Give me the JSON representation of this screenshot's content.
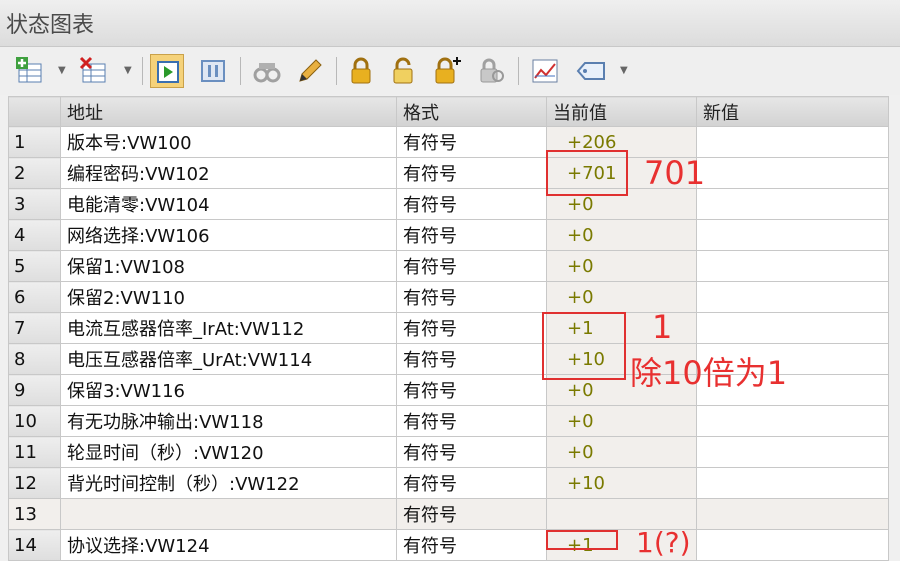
{
  "window": {
    "title": "状态图表"
  },
  "toolbar": {
    "buttons": [
      {
        "icon": "insert-row-icon"
      },
      {
        "icon": "delete-row-icon"
      },
      {
        "icon": "monitor-start-icon"
      },
      {
        "icon": "monitor-pause-icon"
      },
      {
        "icon": "read-icon"
      },
      {
        "icon": "write-pencil-icon"
      },
      {
        "icon": "force-lock-icon"
      },
      {
        "icon": "unforce-unlock-icon"
      },
      {
        "icon": "unforce-all-icon"
      },
      {
        "icon": "read-all-forced-icon"
      },
      {
        "icon": "trend-chart-icon"
      },
      {
        "icon": "tag-icon"
      }
    ]
  },
  "table": {
    "columns": [
      "",
      "地址",
      "格式",
      "当前值",
      "新值"
    ],
    "rows": [
      {
        "num": "1",
        "address": "版本号:VW100",
        "format": "有符号",
        "value": "+206",
        "new": ""
      },
      {
        "num": "2",
        "address": "编程密码:VW102",
        "format": "有符号",
        "value": "+701",
        "new": ""
      },
      {
        "num": "3",
        "address": "电能清零:VW104",
        "format": "有符号",
        "value": "+0",
        "new": ""
      },
      {
        "num": "4",
        "address": "网络选择:VW106",
        "format": "有符号",
        "value": "+0",
        "new": ""
      },
      {
        "num": "5",
        "address": "保留1:VW108",
        "format": "有符号",
        "value": "+0",
        "new": ""
      },
      {
        "num": "6",
        "address": "保留2:VW110",
        "format": "有符号",
        "value": "+0",
        "new": ""
      },
      {
        "num": "7",
        "address": "电流互感器倍率_IrAt:VW112",
        "format": "有符号",
        "value": "+1",
        "new": ""
      },
      {
        "num": "8",
        "address": "电压互感器倍率_UrAt:VW114",
        "format": "有符号",
        "value": "+10",
        "new": ""
      },
      {
        "num": "9",
        "address": "保留3:VW116",
        "format": "有符号",
        "value": "+0",
        "new": ""
      },
      {
        "num": "10",
        "address": "有无功脉冲输出:VW118",
        "format": "有符号",
        "value": "+0",
        "new": ""
      },
      {
        "num": "11",
        "address": "轮显时间（秒）:VW120",
        "format": "有符号",
        "value": "+0",
        "new": ""
      },
      {
        "num": "12",
        "address": "背光时间控制（秒）:VW122",
        "format": "有符号",
        "value": "+10",
        "new": ""
      },
      {
        "num": "13",
        "address": "",
        "format": "有符号",
        "value": "",
        "new": ""
      },
      {
        "num": "14",
        "address": "协议选择:VW124",
        "format": "有符号",
        "value": "+1",
        "new": ""
      }
    ]
  },
  "annotations": {
    "note_701": "701",
    "note_1": "1",
    "note_div10": "除10倍为1",
    "note_cut": "1(?)",
    "color": "#e03030"
  }
}
